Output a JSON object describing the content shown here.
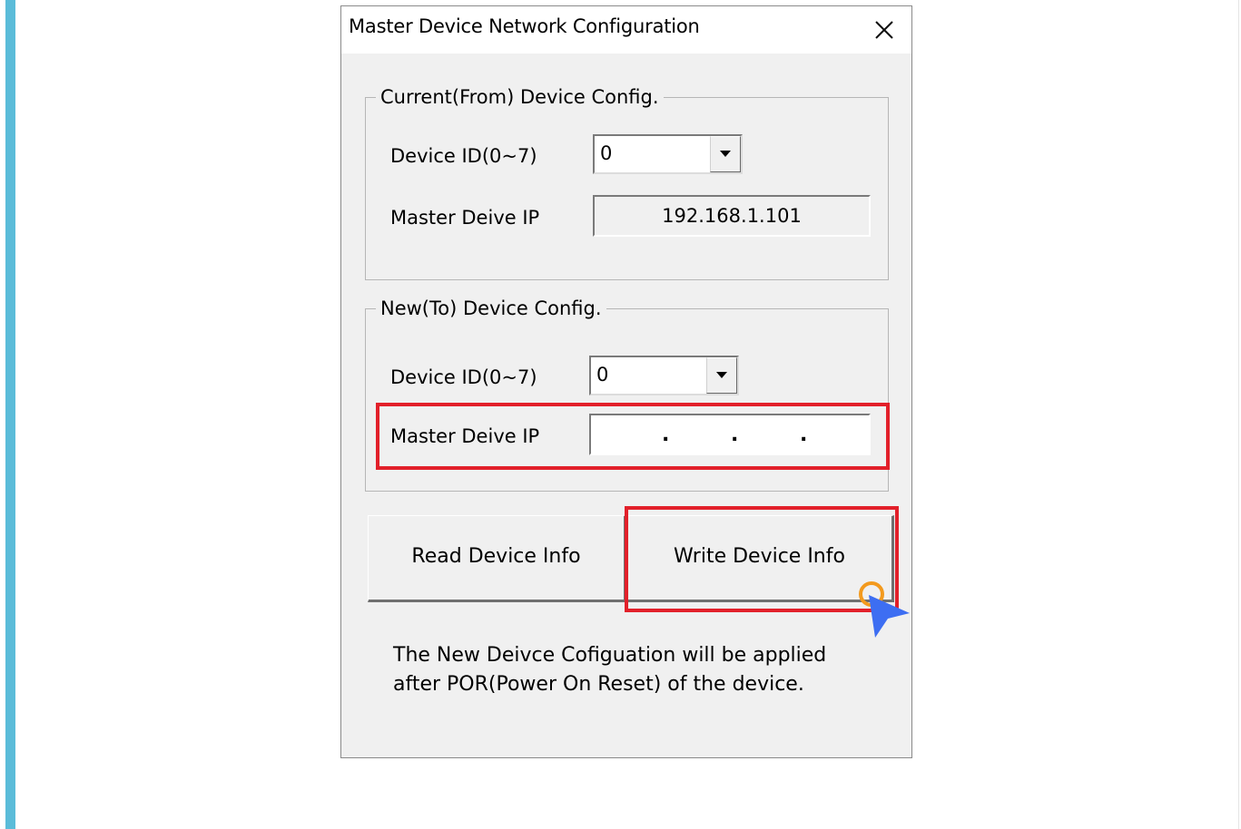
{
  "dialog": {
    "title": "Master Device Network Configuration",
    "close_icon": "close-icon"
  },
  "current_group": {
    "title": "Current(From) Device Config.",
    "device_id_label": "Device ID(0~7)",
    "device_id_value": "0",
    "ip_label": "Master Deive IP",
    "ip_value": "192.168.1.101"
  },
  "new_group": {
    "title": "New(To) Device Config.",
    "device_id_label": "Device ID(0~7)",
    "device_id_value": "0",
    "ip_label": "Master Deive IP",
    "ip_separators": [
      ".",
      ".",
      "."
    ]
  },
  "buttons": {
    "read": "Read Device Info",
    "write": "Write Device Info"
  },
  "note": {
    "line1": "The New Deivce Cofiguation will be applied",
    "line2": "after POR(Power On Reset) of the device."
  },
  "colors": {
    "highlight": "#e2202a",
    "accent_bar": "#5bbcd9",
    "cursor": "#3d6ef2",
    "click_ring": "#f39a1e"
  },
  "icons": {
    "dropdown": "chevron-down-icon",
    "pointer": "mouse-pointer-icon"
  }
}
